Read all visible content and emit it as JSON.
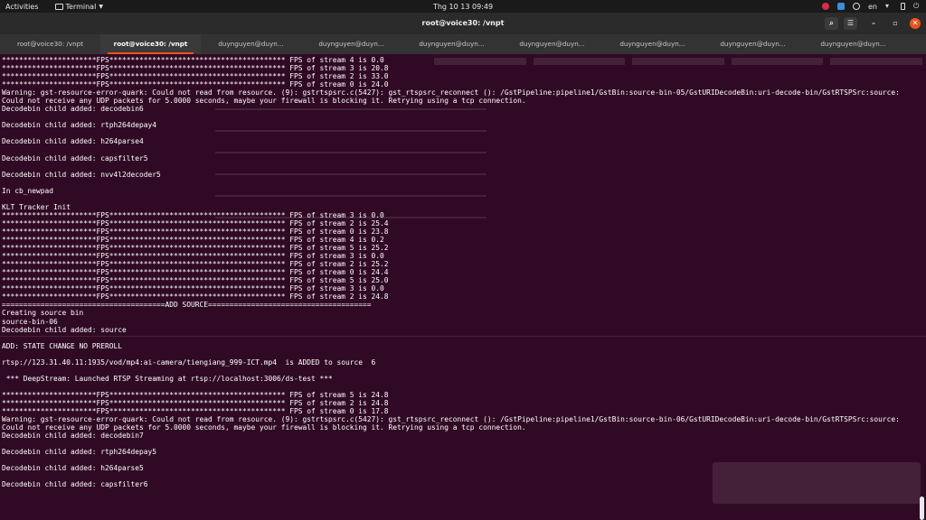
{
  "topbar": {
    "activities": "Activities",
    "app_name": "Terminal",
    "clock": "Thg 10 13  09:49",
    "lang": "en"
  },
  "window": {
    "title": "root@voice30: /vnpt"
  },
  "tabs": [
    {
      "label": "root@voice30: /vnpt",
      "active": false
    },
    {
      "label": "root@voice30: /vnpt",
      "active": true
    },
    {
      "label": "duynguyen@duyn...",
      "active": false
    },
    {
      "label": "duynguyen@duyn...",
      "active": false
    },
    {
      "label": "duynguyen@duyn...",
      "active": false
    },
    {
      "label": "duynguyen@duyn...",
      "active": false
    },
    {
      "label": "duynguyen@duyn...",
      "active": false
    },
    {
      "label": "duynguyen@duyn...",
      "active": false
    },
    {
      "label": "duynguyen@duyn...",
      "active": false
    }
  ],
  "terminal": {
    "lines": [
      "**********************FPS***************************************** FPS of stream 4 is 0.0",
      "**********************FPS***************************************** FPS of stream 3 is 20.8",
      "**********************FPS***************************************** FPS of stream 2 is 33.0",
      "**********************FPS***************************************** FPS of stream 0 is 24.0",
      "Warning: gst-resource-error-quark: Could not read from resource. (9): gstrtspsrc.c(5427): gst_rtspsrc_reconnect (): /GstPipeline:pipeline1/GstBin:source-bin-05/GstURIDecodeBin:uri-decode-bin/GstRTSPSrc:source:",
      "Could not receive any UDP packets for 5.0000 seconds, maybe your firewall is blocking it. Retrying using a tcp connection.",
      "Decodebin child added: decodebin6",
      "",
      "Decodebin child added: rtph264depay4",
      "",
      "Decodebin child added: h264parse4",
      "",
      "Decodebin child added: capsfilter5",
      "",
      "Decodebin child added: nvv4l2decoder5",
      "",
      "In cb_newpad",
      "",
      "KLT Tracker Init",
      "**********************FPS***************************************** FPS of stream 3 is 0.0",
      "**********************FPS***************************************** FPS of stream 2 is 25.4",
      "**********************FPS***************************************** FPS of stream 0 is 23.8",
      "**********************FPS***************************************** FPS of stream 4 is 0.2",
      "**********************FPS***************************************** FPS of stream 5 is 25.2",
      "**********************FPS***************************************** FPS of stream 3 is 0.0",
      "**********************FPS***************************************** FPS of stream 2 is 25.2",
      "**********************FPS***************************************** FPS of stream 0 is 24.4",
      "**********************FPS***************************************** FPS of stream 5 is 25.0",
      "**********************FPS***************************************** FPS of stream 3 is 0.0",
      "**********************FPS***************************************** FPS of stream 2 is 24.8",
      "======================================ADD SOURCE======================================",
      "Creating source bin",
      "source-bin-06",
      "Decodebin child added: source",
      "",
      "ADD: STATE CHANGE NO PREROLL",
      "",
      "rtsp://123.31.40.11:1935/vod/mp4:ai-camera/tiengiang_999-ICT.mp4  is ADDED to source  6",
      "",
      " *** DeepStream: Launched RTSP Streaming at rtsp://localhost:3006/ds-test ***",
      "",
      "**********************FPS***************************************** FPS of stream 5 is 24.8",
      "**********************FPS***************************************** FPS of stream 2 is 24.8",
      "**********************FPS***************************************** FPS of stream 0 is 17.8",
      "Warning: gst-resource-error-quark: Could not read from resource. (9): gstrtspsrc.c(5427): gst_rtspsrc_reconnect (): /GstPipeline:pipeline1/GstBin:source-bin-06/GstURIDecodeBin:uri-decode-bin/GstRTSPSrc:source:",
      "Could not receive any UDP packets for 5.0000 seconds, maybe your firewall is blocking it. Retrying using a tcp connection.",
      "Decodebin child added: decodebin7",
      "",
      "Decodebin child added: rtph264depay5",
      "",
      "Decodebin child added: h264parse5",
      "",
      "Decodebin child added: capsfilter6",
      ""
    ]
  }
}
